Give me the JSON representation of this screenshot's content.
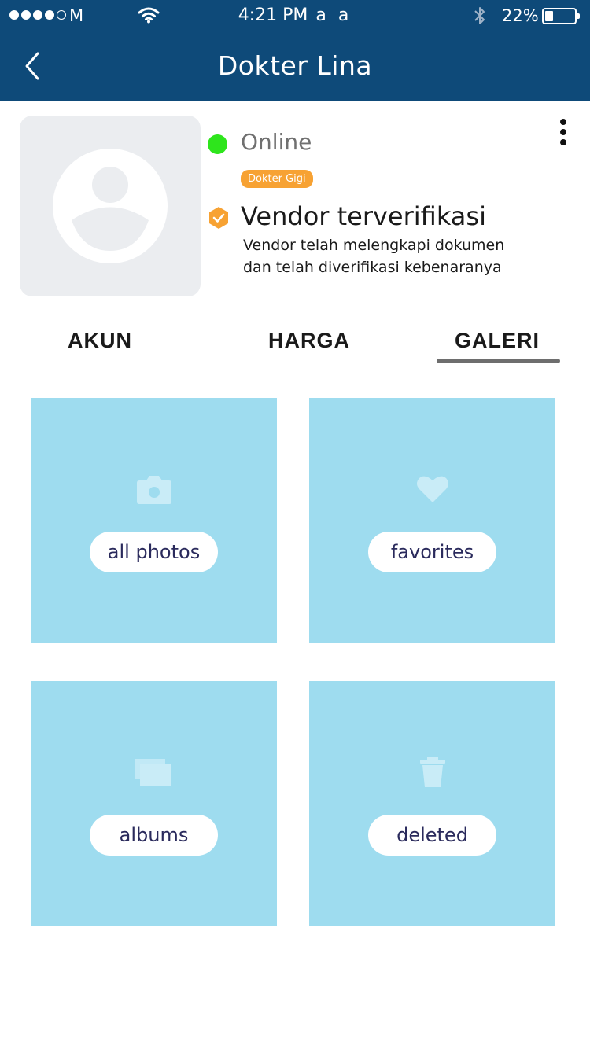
{
  "status_bar": {
    "carrier": "M",
    "time": "4:21 PM",
    "time_suffix": "a a",
    "battery_percent": "22%",
    "signal_filled": 4,
    "signal_total": 5
  },
  "header": {
    "title": "Dokter Lina",
    "background": "#0e4a79",
    "back_icon": "chevron-left-icon"
  },
  "profile": {
    "status": "Online",
    "status_color": "#2ee51c",
    "badge": "Dokter Gigi",
    "badge_color": "#f7a233",
    "verified_title": "Vendor terverifikasi",
    "verified_desc_line1": "Vendor telah melengkapi dokumen",
    "verified_desc_line2": "dan telah diverifikasi kebenaranya",
    "avatar_icon": "user-placeholder-icon",
    "more_icon": "more-vertical-icon"
  },
  "tabs": [
    {
      "label": "AKUN",
      "active": false
    },
    {
      "label": "HARGA",
      "active": false
    },
    {
      "label": "GALERI",
      "active": true
    }
  ],
  "gallery": [
    {
      "label": "all photos",
      "icon": "camera-icon"
    },
    {
      "label": "favorites",
      "icon": "heart-icon"
    },
    {
      "label": "albums",
      "icon": "albums-icon"
    },
    {
      "label": "deleted",
      "icon": "trash-icon"
    }
  ],
  "tile_color": "#9edcef"
}
